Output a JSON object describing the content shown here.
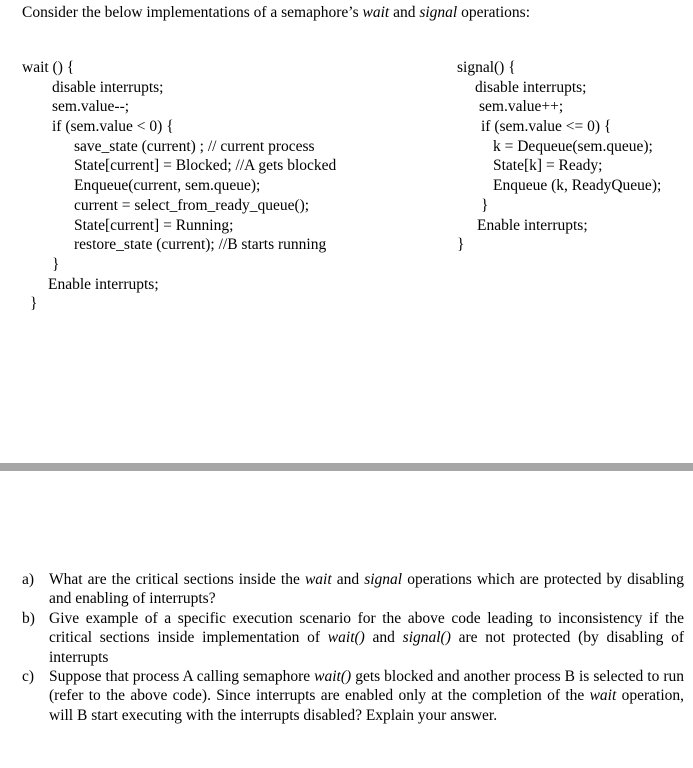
{
  "intro": {
    "prefix": "Consider the below implementations of a semaphore’s ",
    "wait_word": "wait",
    "and_word": " and ",
    "signal_word": "signal",
    "suffix": " operations:"
  },
  "wait_code": [
    {
      "indent": 0,
      "text": "wait () {"
    },
    {
      "indent": 30,
      "text": "disable interrupts;"
    },
    {
      "indent": 30,
      "text": "sem.value--;"
    },
    {
      "indent": 30,
      "text": "if (sem.value < 0) {"
    },
    {
      "indent": 52,
      "text": "save_state (current) ; // current process"
    },
    {
      "indent": 52,
      "text": "State[current] = Blocked; //A gets blocked"
    },
    {
      "indent": 52,
      "text": "Enqueue(current, sem.queue);"
    },
    {
      "indent": 52,
      "text": "current = select_from_ready_queue();"
    },
    {
      "indent": 52,
      "text": "State[current] = Running;"
    },
    {
      "indent": 52,
      "text": "restore_state (current); //B starts running"
    },
    {
      "indent": 30,
      "text": "}"
    },
    {
      "indent": 26,
      "text": "Enable interrupts;"
    },
    {
      "indent": 8,
      "text": "}"
    }
  ],
  "signal_code": [
    {
      "indent": 0,
      "text": "signal() {"
    },
    {
      "indent": 18,
      "text": "disable interrupts;"
    },
    {
      "indent": 22,
      "text": "sem.value++;"
    },
    {
      "indent": 24,
      "text": "if (sem.value <= 0) {"
    },
    {
      "indent": 36,
      "text": "k = Dequeue(sem.queue);"
    },
    {
      "indent": 36,
      "text": "State[k] = Ready;"
    },
    {
      "indent": 36,
      "text": "Enqueue (k, ReadyQueue);"
    },
    {
      "indent": 24,
      "text": "}"
    },
    {
      "indent": 20,
      "text": "Enable interrupts;"
    },
    {
      "indent": 0,
      "text": "}"
    }
  ],
  "questions": [
    {
      "label": "a)",
      "parts": [
        {
          "t": "What are the critical sections inside the ",
          "i": false
        },
        {
          "t": "wait",
          "i": true
        },
        {
          "t": " and ",
          "i": false
        },
        {
          "t": "signal",
          "i": true
        },
        {
          "t": " operations which are protected by disabling and enabling of interrupts?",
          "i": false
        }
      ]
    },
    {
      "label": "b)",
      "parts": [
        {
          "t": "Give example of a specific execution scenario for the above code leading to inconsistency if the critical sections inside implementation of ",
          "i": false
        },
        {
          "t": "wait()",
          "i": true
        },
        {
          "t": " and ",
          "i": false
        },
        {
          "t": "signal()",
          "i": true
        },
        {
          "t": " are not protected (by disabling of interrupts",
          "i": false
        }
      ]
    },
    {
      "label": "c)",
      "parts": [
        {
          "t": "Suppose that process A calling semaphore ",
          "i": false
        },
        {
          "t": "wait()",
          "i": true
        },
        {
          "t": " gets blocked and another process B is selected to run (refer to the above code). Since interrupts are enabled only at the completion of the ",
          "i": false
        },
        {
          "t": "wait",
          "i": true
        },
        {
          "t": " operation, will B start executing with the interrupts disabled? Explain your answer.",
          "i": false
        }
      ]
    }
  ]
}
